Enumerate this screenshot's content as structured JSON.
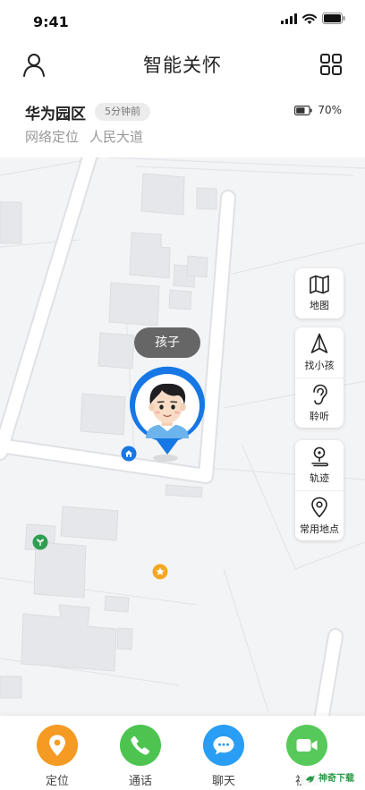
{
  "status_bar": {
    "time": "9:41"
  },
  "nav": {
    "title": "智能关怀",
    "user_icon": "user-icon",
    "menu_icon": "grid-icon"
  },
  "info": {
    "location_name": "华为园区",
    "time_ago": "5分钟前",
    "battery": "70%",
    "battery_level": 0.7,
    "locate_method": "网络定位",
    "street": "人民大道"
  },
  "map": {
    "child_label": "孩子",
    "pin_color": "#1677e5",
    "poi": [
      {
        "icon": "home-icon",
        "color": "#1677e5"
      },
      {
        "icon": "school-icon",
        "color": "#2e9e50"
      },
      {
        "icon": "star-icon",
        "color": "#f5a623"
      }
    ]
  },
  "tools": {
    "map_label": "地图",
    "find_child_label": "找小孩",
    "listen_label": "聆听",
    "track_label": "轨迹",
    "places_label": "常用地点"
  },
  "tabs": [
    {
      "label": "定位",
      "color": "#f59a23",
      "icon": "location-icon"
    },
    {
      "label": "通话",
      "color": "#4cc44f",
      "icon": "phone-icon"
    },
    {
      "label": "聊天",
      "color": "#2a9df4",
      "icon": "chat-icon"
    },
    {
      "label": "视频",
      "color": "#57c95a",
      "icon": "video-icon"
    }
  ],
  "watermark": "神奇下载"
}
